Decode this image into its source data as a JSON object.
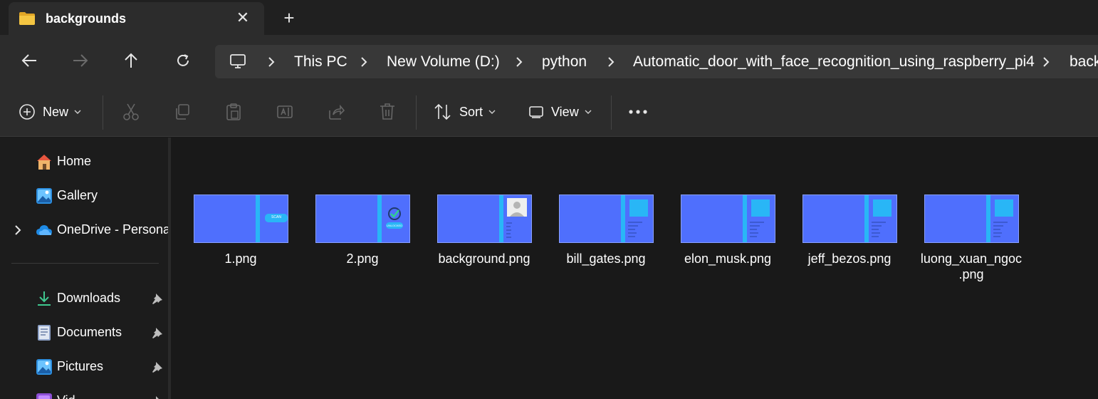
{
  "tab": {
    "title": "backgrounds",
    "close_symbol": "✕",
    "new_tab_symbol": "+"
  },
  "breadcrumb": {
    "items": [
      "This PC",
      "New Volume (D:)",
      "python",
      "Automatic_door_with_face_recognition_using_raspberry_pi4",
      "back"
    ]
  },
  "commands": {
    "new_label": "New",
    "sort_label": "Sort",
    "view_label": "View"
  },
  "sidebar": {
    "items": [
      {
        "label": "Home",
        "icon": "home-icon"
      },
      {
        "label": "Gallery",
        "icon": "gallery-icon"
      },
      {
        "label": "OneDrive - Persona",
        "icon": "cloud-icon"
      },
      {
        "label": "Downloads",
        "icon": "download-icon",
        "pinned": true
      },
      {
        "label": "Documents",
        "icon": "documents-icon",
        "pinned": true
      },
      {
        "label": "Pictures",
        "icon": "pictures-icon",
        "pinned": true
      },
      {
        "label": "Vid",
        "icon": "videos-icon",
        "pinned": true
      }
    ]
  },
  "files": [
    {
      "name": "1.png",
      "thumb_text": "SCAN"
    },
    {
      "name": "2.png",
      "thumb_text": "UNLOCKED"
    },
    {
      "name": "background.png"
    },
    {
      "name": "bill_gates.png"
    },
    {
      "name": "elon_musk.png"
    },
    {
      "name": "jeff_bezos.png"
    },
    {
      "name_line1": "luong_xuan_ngoc",
      "name_line2": ".png"
    }
  ],
  "colors": {
    "thumb_bg": "#4f6ffd",
    "thumb_accent": "#29b6f6",
    "folder": "#f4c542"
  }
}
